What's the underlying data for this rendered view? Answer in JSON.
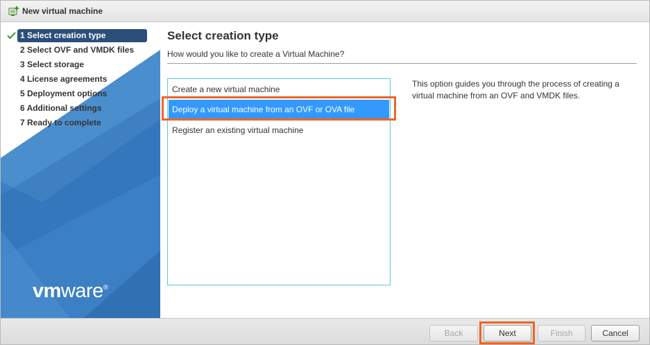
{
  "window": {
    "title": "New virtual machine",
    "icon": "new-vm-icon"
  },
  "sidebar": {
    "steps": [
      {
        "label": "1 Select creation type",
        "active": true,
        "completed": true
      },
      {
        "label": "2 Select OVF and VMDK files",
        "active": false,
        "completed": false
      },
      {
        "label": "3 Select storage",
        "active": false,
        "completed": false
      },
      {
        "label": "4 License agreements",
        "active": false,
        "completed": false
      },
      {
        "label": "5 Deployment options",
        "active": false,
        "completed": false
      },
      {
        "label": "6 Additional settings",
        "active": false,
        "completed": false
      },
      {
        "label": "7 Ready to complete",
        "active": false,
        "completed": false
      }
    ],
    "logo": {
      "part1": "vm",
      "part2": "ware",
      "reg": "®"
    },
    "accent": "#2b4e7b"
  },
  "main": {
    "title": "Select creation type",
    "subtitle": "How would you like to create a Virtual Machine?",
    "options": [
      {
        "label": "Create a new virtual machine",
        "selected": false
      },
      {
        "label": "Deploy a virtual machine from an OVF or OVA file",
        "selected": true
      },
      {
        "label": "Register an existing virtual machine",
        "selected": false
      }
    ],
    "description": "This option guides you through the process of creating a virtual machine from an OVF and VMDK files."
  },
  "footer": {
    "back_label": "Back",
    "next_label": "Next",
    "finish_label": "Finish",
    "cancel_label": "Cancel"
  },
  "colors": {
    "selection": "#3399ff",
    "highlight": "#f06424",
    "sidebar_blue": "#3d82c8"
  }
}
